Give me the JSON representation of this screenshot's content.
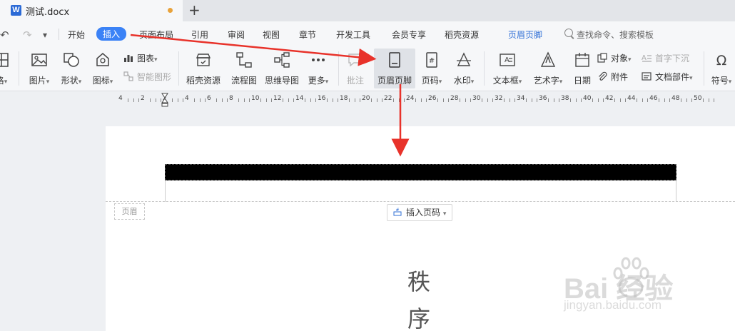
{
  "titlebar": {
    "doc_icon": "W",
    "doc_title": "测试.docx",
    "new_tab_icon": "+"
  },
  "quick_access": {
    "undo_icon": "↶",
    "redo_icon": "↷",
    "dropdown_icon": "▾"
  },
  "menu": {
    "items": [
      "开始",
      "插入",
      "页面布局",
      "引用",
      "审阅",
      "视图",
      "章节",
      "开发工具",
      "会员专享",
      "稻壳资源",
      "页眉页脚"
    ],
    "active": "插入",
    "search_placeholder": "查找命令、搜索模板"
  },
  "ribbon": {
    "partial_left": "格",
    "picture": "图片",
    "shape": "形状",
    "icon": "图标",
    "chart": "图表",
    "smart_graphic": "智能图形",
    "daoke": "稻壳资源",
    "flowchart": "流程图",
    "mindmap": "思维导图",
    "more": "更多",
    "comment": "批注",
    "header_footer": "页眉页脚",
    "page_number": "页码",
    "watermark": "水印",
    "textbox": "文本框",
    "wordart": "艺术字",
    "date": "日期",
    "object": "对象",
    "attachment": "附件",
    "dropcap": "首字下沉",
    "doc_parts": "文档部件",
    "symbol": "符号",
    "caret": "▾"
  },
  "ruler": {
    "numbers": [
      "4",
      "2",
      "2",
      "4",
      "6",
      "8",
      "10",
      "12",
      "14",
      "16",
      "18",
      "20",
      "22",
      "24",
      "26",
      "28",
      "30",
      "32",
      "34",
      "36",
      "38",
      "40",
      "42",
      "44",
      "46",
      "48",
      "50"
    ]
  },
  "page": {
    "header_label": "页眉",
    "insert_page_number": "插入页码",
    "body_chars": [
      "秩",
      "序"
    ]
  },
  "watermark": {
    "brand": "Bai  经验",
    "url": "jingyan.baidu.com"
  },
  "colors": {
    "accent": "#3b82f6",
    "arrow": "#e8322a",
    "context_tab": "#2f6fd6"
  }
}
